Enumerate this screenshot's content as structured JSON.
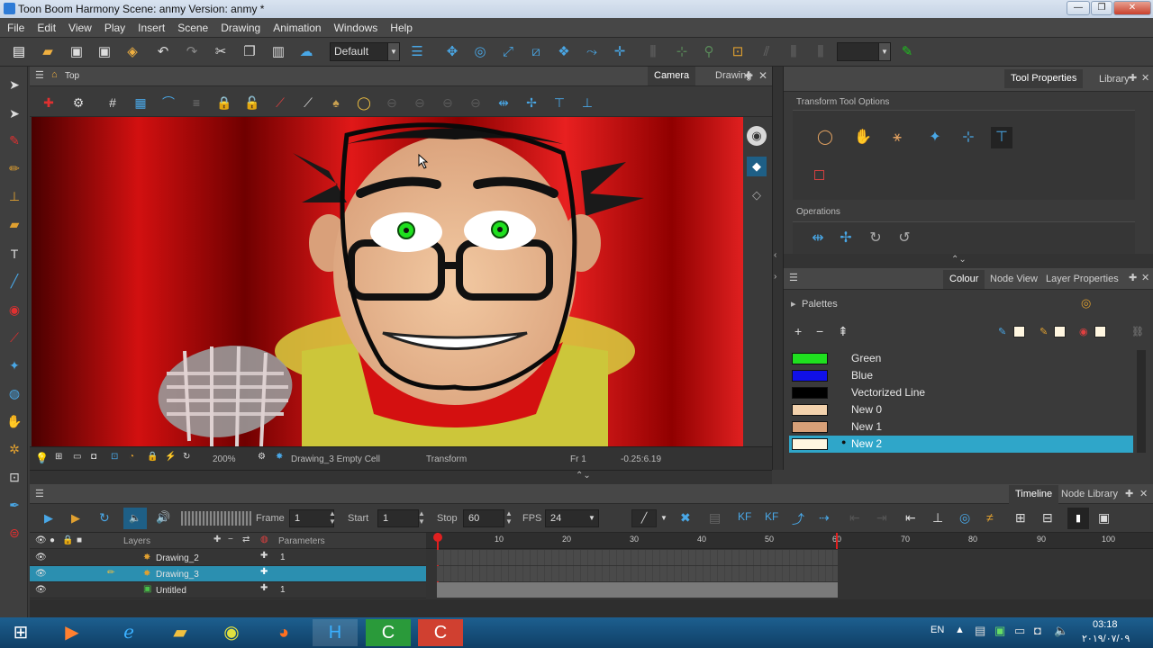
{
  "window": {
    "title": "Toon Boom Harmony Scene: anmy Version: anmy *",
    "minimize": "—",
    "maximize": "❐",
    "close": "✕"
  },
  "menu": [
    "File",
    "Edit",
    "View",
    "Play",
    "Insert",
    "Scene",
    "Drawing",
    "Animation",
    "Windows",
    "Help"
  ],
  "toolbar": {
    "workspace": "Default"
  },
  "camera_view": {
    "breadcrumb": "Top",
    "tab_camera": "Camera",
    "tab_drawing": "Drawing",
    "zoom": "200%",
    "cell": "Drawing_3 Empty Cell",
    "tool": "Transform",
    "frame": "Fr 1",
    "coords": "-0.25:6.19"
  },
  "tool_properties": {
    "tab_tool_properties": "Tool Properties",
    "tab_library": "Library",
    "section_options": "Transform Tool Options",
    "section_operations": "Operations"
  },
  "colour_panel": {
    "tab_colour": "Colour",
    "tab_node_view": "Node View",
    "tab_layer_properties": "Layer Properties",
    "palettes_label": "Palettes",
    "swatches": [
      {
        "name": "Green",
        "color": "#1fe01f"
      },
      {
        "name": "Blue",
        "color": "#1010e8"
      },
      {
        "name": "Vectorized Line",
        "color": "#000000"
      },
      {
        "name": "New 0",
        "color": "#f3d2ad"
      },
      {
        "name": "New 1",
        "color": "#d8a078"
      },
      {
        "name": "New 2",
        "color": "#fff6e0"
      }
    ],
    "selected": "New 2"
  },
  "timeline": {
    "tab_timeline": "Timeline",
    "tab_node_library": "Node Library",
    "frame_label": "Frame",
    "frame": "1",
    "start_label": "Start",
    "start": "1",
    "stop_label": "Stop",
    "stop": "60",
    "fps_label": "FPS",
    "fps": "24",
    "layers_header": "Layers",
    "params_header": "Parameters",
    "layers": [
      {
        "name": "Drawing_2",
        "param": "1"
      },
      {
        "name": "Drawing_3",
        "param": ""
      },
      {
        "name": "Untitled",
        "param": "1"
      }
    ],
    "ruler": [
      "10",
      "20",
      "30",
      "40",
      "50",
      "60",
      "70",
      "80",
      "90",
      "100"
    ]
  },
  "taskbar": {
    "lang": "EN",
    "time": "03:18",
    "date": "٢٠١٩/٠٧/٠٩"
  }
}
